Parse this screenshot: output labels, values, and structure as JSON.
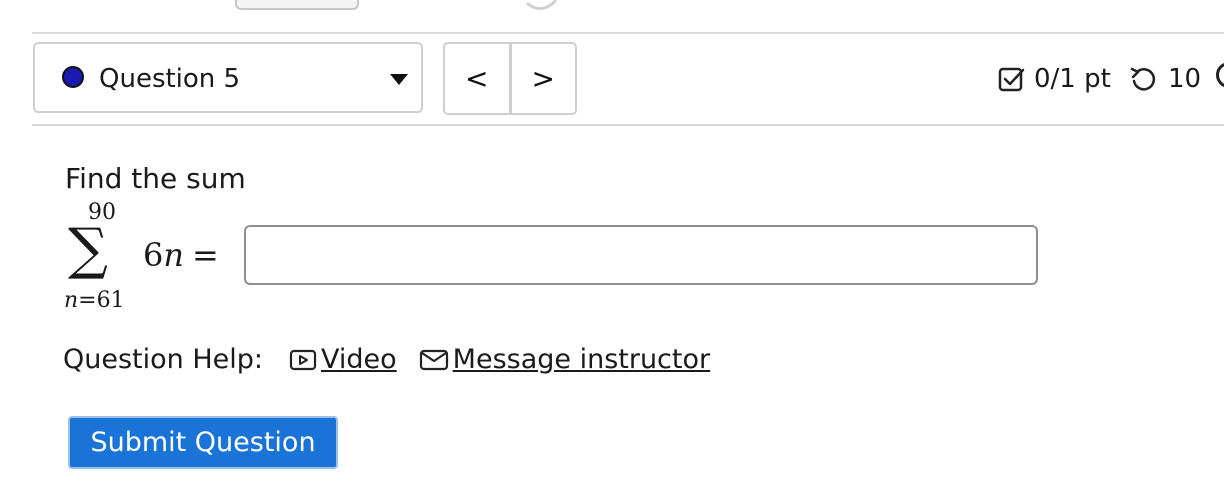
{
  "question_selector": {
    "label": "Question 5",
    "status_color": "#1a1ab0"
  },
  "nav": {
    "prev": "<",
    "next": ">"
  },
  "score": {
    "points": "0/1 pt",
    "retries": "10"
  },
  "question": {
    "prompt": "Find the sum",
    "sum_upper": "90",
    "sum_lower_var": "n",
    "sum_lower_eq": "=",
    "sum_lower_val": "61",
    "sigma": "∑",
    "term_coef": "6",
    "term_var": "n",
    "equals": "=",
    "answer_value": ""
  },
  "help": {
    "label": "Question Help:",
    "video": "Video",
    "message": "Message instructor"
  },
  "submit_label": "Submit Question",
  "colors": {
    "accent": "#1a73d6"
  }
}
